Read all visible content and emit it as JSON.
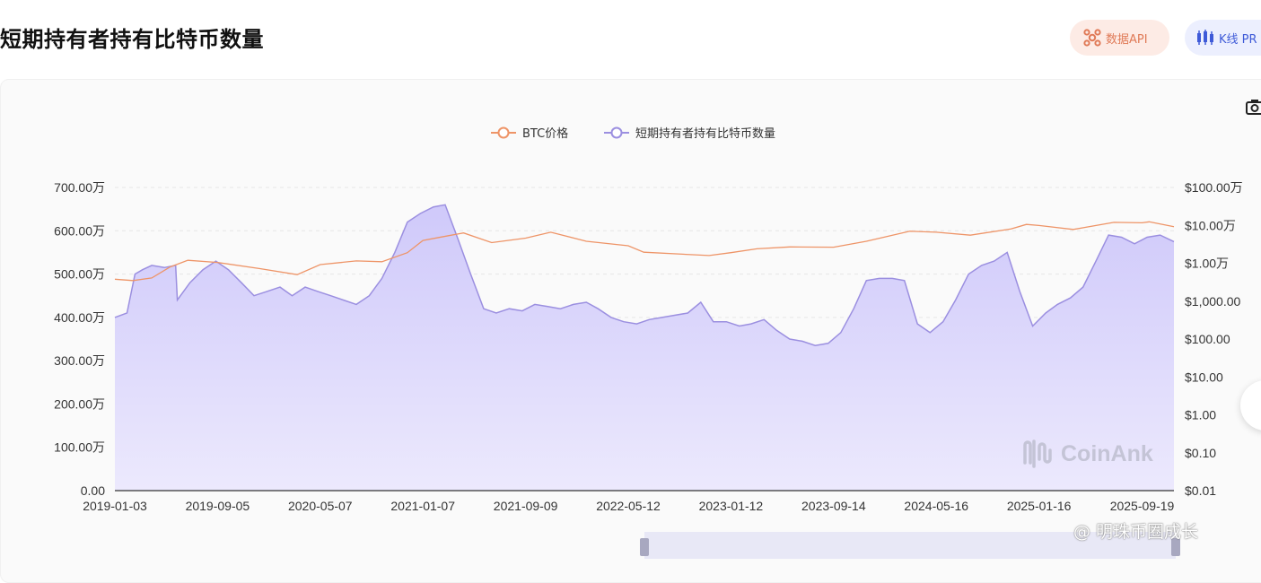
{
  "page_title": "短期持有者持有比特币数量",
  "header_buttons": {
    "api_label": "数据API",
    "kline_label": "K线 PR"
  },
  "watermark": {
    "logo_text": "CoinAnk",
    "bottom_text": "@ 明珠币圈成长"
  },
  "colors": {
    "btc": "#ee9467",
    "sth": "#9b8fe0",
    "sth_fill": "#d8d3fb",
    "api_icon": "#e07a57",
    "kline_icon": "#3f5bd8"
  },
  "chart_data": {
    "type": "area",
    "legend": {
      "position": "top-center",
      "items": [
        "BTC价格",
        "短期持有者持有比特币数量"
      ]
    },
    "x_tick_labels": [
      "2019-01-03",
      "2019-09-05",
      "2020-05-07",
      "2021-01-07",
      "2021-09-09",
      "2022-05-12",
      "2023-01-12",
      "2023-09-14",
      "2024-05-16",
      "2025-01-16",
      "2025-09-19"
    ],
    "xlim": [
      "2019-01-03",
      "2025-12-04"
    ],
    "y_left": {
      "ticks": [
        "0.00",
        "100.00万",
        "200.00万",
        "300.00万",
        "400.00万",
        "500.00万",
        "600.00万",
        "700.00万"
      ],
      "range": [
        0,
        7000000
      ]
    },
    "y_right": {
      "scale": "log",
      "ticks": [
        "$0.01",
        "$0.10",
        "$1.00",
        "$10.00",
        "$100.00",
        "$1,000.00",
        "$1.00万",
        "$10.00万",
        "$100.00万"
      ],
      "range": [
        0.01,
        1000000
      ]
    },
    "grid": true,
    "series": [
      {
        "name": "短期持有者持有比特币数量",
        "axis": "left",
        "x": [
          "2019-01-03",
          "2019-02-01",
          "2019-02-20",
          "2019-03-10",
          "2019-04-01",
          "2019-05-01",
          "2019-05-28",
          "2019-06-01",
          "2019-07-01",
          "2019-08-01",
          "2019-09-01",
          "2019-10-01",
          "2019-11-01",
          "2019-12-01",
          "2020-01-01",
          "2020-02-01",
          "2020-03-01",
          "2020-04-01",
          "2020-05-01",
          "2020-06-01",
          "2020-07-01",
          "2020-08-01",
          "2020-09-01",
          "2020-10-01",
          "2020-11-01",
          "2020-12-01",
          "2021-01-01",
          "2021-02-01",
          "2021-03-01",
          "2021-04-01",
          "2021-05-01",
          "2021-06-01",
          "2021-07-01",
          "2021-08-01",
          "2021-09-01",
          "2021-10-01",
          "2021-11-01",
          "2021-12-01",
          "2022-01-01",
          "2022-02-01",
          "2022-03-01",
          "2022-04-01",
          "2022-05-01",
          "2022-06-01",
          "2022-07-01",
          "2022-08-01",
          "2022-09-01",
          "2022-10-01",
          "2022-11-01",
          "2022-12-01",
          "2023-01-01",
          "2023-02-01",
          "2023-03-01",
          "2023-04-01",
          "2023-05-01",
          "2023-06-01",
          "2023-07-01",
          "2023-08-01",
          "2023-09-01",
          "2023-10-01",
          "2023-11-01",
          "2023-12-01",
          "2024-01-01",
          "2024-02-01",
          "2024-03-01",
          "2024-04-01",
          "2024-05-01",
          "2024-06-01",
          "2024-07-01",
          "2024-08-01",
          "2024-09-01",
          "2024-10-01",
          "2024-11-01",
          "2024-12-01",
          "2025-01-01",
          "2025-02-01",
          "2025-03-01",
          "2025-04-01",
          "2025-05-01",
          "2025-06-01",
          "2025-07-01",
          "2025-08-01",
          "2025-09-01",
          "2025-10-01",
          "2025-11-01",
          "2025-12-04"
        ],
        "values": [
          4000000,
          4100000,
          5000000,
          5100000,
          5200000,
          5150000,
          5200000,
          4400000,
          4800000,
          5100000,
          5300000,
          5100000,
          4800000,
          4500000,
          4600000,
          4700000,
          4500000,
          4700000,
          4600000,
          4500000,
          4400000,
          4300000,
          4500000,
          4900000,
          5500000,
          6200000,
          6400000,
          6550000,
          6600000,
          5800000,
          5000000,
          4200000,
          4100000,
          4200000,
          4150000,
          4300000,
          4250000,
          4200000,
          4300000,
          4350000,
          4200000,
          4000000,
          3900000,
          3850000,
          3950000,
          4000000,
          4050000,
          4100000,
          4350000,
          3900000,
          3900000,
          3800000,
          3850000,
          3950000,
          3700000,
          3500000,
          3450000,
          3350000,
          3400000,
          3650000,
          4200000,
          4850000,
          4900000,
          4900000,
          4850000,
          3850000,
          3650000,
          3900000,
          4400000,
          5000000,
          5200000,
          5300000,
          5500000,
          4600000,
          3800000,
          4100000,
          4300000,
          4450000,
          4700000,
          5300000,
          5900000,
          5850000,
          5700000,
          5850000,
          5900000,
          5750000
        ]
      },
      {
        "name": "BTC价格",
        "axis": "right",
        "x": [
          "2019-01-03",
          "2019-02-15",
          "2019-04-01",
          "2019-05-15",
          "2019-06-26",
          "2019-09-05",
          "2019-12-15",
          "2020-03-13",
          "2020-05-07",
          "2020-08-01",
          "2020-10-01",
          "2020-12-01",
          "2021-01-07",
          "2021-02-15",
          "2021-04-14",
          "2021-06-20",
          "2021-09-09",
          "2021-11-08",
          "2022-02-01",
          "2022-05-12",
          "2022-06-18",
          "2022-11-21",
          "2023-01-12",
          "2023-03-15",
          "2023-06-01",
          "2023-09-14",
          "2023-12-01",
          "2024-03-14",
          "2024-05-16",
          "2024-08-05",
          "2024-11-10",
          "2024-12-17",
          "2025-01-16",
          "2025-04-08",
          "2025-07-14",
          "2025-09-19",
          "2025-10-06",
          "2025-12-04"
        ],
        "values": [
          3800,
          3500,
          4100,
          8000,
          12000,
          10500,
          7200,
          5000,
          9200,
          11500,
          11000,
          19000,
          40000,
          48000,
          63000,
          35000,
          46000,
          66000,
          38000,
          29000,
          19500,
          16000,
          19000,
          24000,
          27000,
          26500,
          38000,
          70000,
          66000,
          55000,
          80000,
          106000,
          99000,
          78000,
          120000,
          117000,
          124000,
          92000
        ]
      }
    ]
  }
}
